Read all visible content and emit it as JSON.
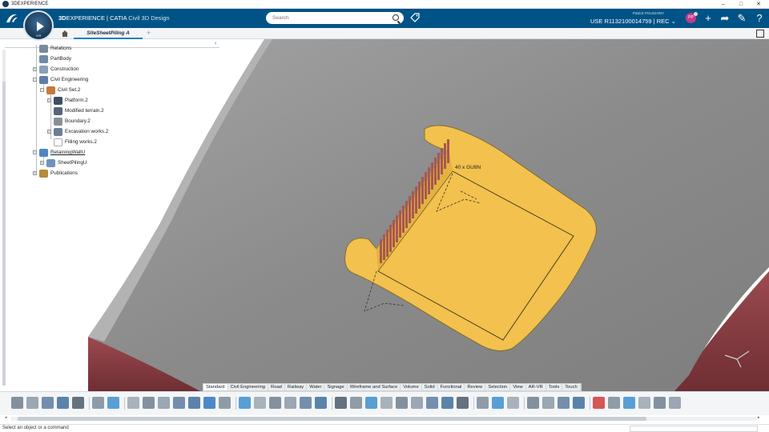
{
  "window": {
    "title": "3DEXPERIENCE",
    "controls": {
      "minimize": "–",
      "maximize": "□",
      "close": "✕"
    }
  },
  "compass": {
    "version": "V.R"
  },
  "brand": {
    "prefix": "3D",
    "name": "EXPERIENCE",
    "product": "| CATIA",
    "app": "Civil 3D Design"
  },
  "search": {
    "placeholder": "Search"
  },
  "user": {
    "name": "Patrick POUGHINY",
    "context": "USE R1132100014759 | REC ⌄",
    "initials": "PP"
  },
  "tabs": {
    "active": "SiteSheetPiling A",
    "add": "+"
  },
  "tree": {
    "collapse_label": "‹",
    "nodes": [
      {
        "label": "Relations",
        "color": "#7a8a9a"
      },
      {
        "label": "PartBody",
        "color": "#6f8ba6"
      },
      {
        "label": "Construction",
        "color": "#8aa0b4"
      },
      {
        "label": "Civil Engineering",
        "color": "#5d7fa3"
      },
      {
        "label": "Civil Set.2",
        "color": "#c77a3a"
      },
      {
        "label": "Platform.2",
        "color": "#3f4f5e"
      },
      {
        "label": "Modified terrain.2",
        "color": "#55657a"
      },
      {
        "label": "Boundary.2",
        "color": "#8a8f96"
      },
      {
        "label": "Excavation works.2",
        "color": "#6a7f95"
      },
      {
        "label": "Filling works.2",
        "color": "#ffffff"
      },
      {
        "label": "RetainingWallU",
        "color": "#4f86c0"
      },
      {
        "label": "SheetPilingU",
        "color": "#6c95bd"
      },
      {
        "label": "Publications",
        "color": "#b58a3a"
      }
    ]
  },
  "viewport": {
    "annotation": "40 x GU8N"
  },
  "section_tabs": [
    "Standard",
    "Civil Engineering",
    "Road",
    "Railway",
    "Water",
    "Signage",
    "Wireframe and Surface",
    "Volume",
    "Solid",
    "Functional",
    "Review",
    "Selection",
    "View",
    "AR-VR",
    "Tools",
    "Touch"
  ],
  "active_section": "Standard",
  "status": {
    "message": "Select an object or a command"
  },
  "colors": {
    "topbar": "#005386",
    "terrain": "#8c8c8c",
    "platform": "#f2c14e",
    "platform_edge": "#7a6520",
    "sheet_piles": "#a8584e",
    "terrain_side": "#8c3f45"
  },
  "toolbar_icons": [
    "cut-icon",
    "copy-icon",
    "paste-icon",
    "undo-icon",
    "zoom-icon",
    "book-icon",
    "refresh-icon",
    "tool-icon",
    "select-icon",
    "table-icon",
    "catalog-icon",
    "capture-icon",
    "star-icon",
    "list-icon",
    "tree-icon",
    "gear-icon",
    "measure-icon",
    "sphere-icon",
    "link-icon",
    "structure-icon",
    "formula-icon",
    "sketch-icon",
    "grid-icon",
    "tag-icon",
    "print-icon",
    "check-icon",
    "scan-icon",
    "cylinder-icon",
    "bar-icon",
    "move-icon",
    "box-icon",
    "pen-icon",
    "cube-icon",
    "frame-icon",
    "filter-icon",
    "tape-icon",
    "color-icon",
    "render-icon",
    "assembly-icon",
    "layout-icon",
    "window-icon",
    "split-icon"
  ]
}
